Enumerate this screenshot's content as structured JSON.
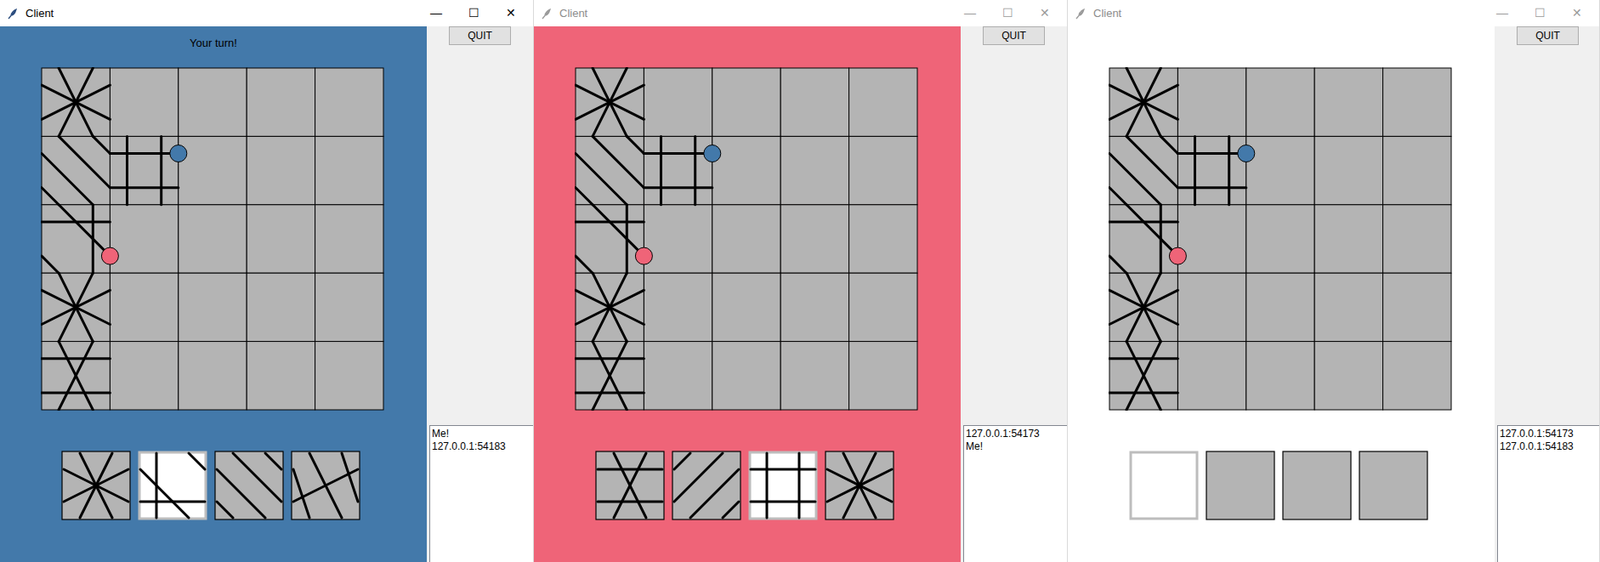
{
  "board": {
    "rows": 5,
    "cols": 5,
    "tiles": [
      {
        "row": 0,
        "col": 0,
        "paths": [
          [
            0,
            4
          ],
          [
            1,
            5
          ],
          [
            2,
            6
          ],
          [
            3,
            7
          ]
        ]
      },
      {
        "row": 1,
        "col": 0,
        "paths": [
          [
            1,
            2
          ],
          [
            0,
            3
          ],
          [
            7,
            4
          ],
          [
            6,
            5
          ]
        ]
      },
      {
        "row": 1,
        "col": 1,
        "paths": [
          [
            7,
            2
          ],
          [
            0,
            5
          ],
          [
            1,
            4
          ],
          [
            6,
            3
          ]
        ]
      },
      {
        "row": 2,
        "col": 0,
        "paths": [
          [
            7,
            2
          ],
          [
            1,
            4
          ],
          [
            6,
            5
          ],
          [
            0,
            3
          ]
        ]
      },
      {
        "row": 3,
        "col": 0,
        "paths": [
          [
            0,
            4
          ],
          [
            1,
            5
          ],
          [
            2,
            6
          ],
          [
            3,
            7
          ]
        ]
      },
      {
        "row": 4,
        "col": 0,
        "paths": [
          [
            7,
            2
          ],
          [
            0,
            4
          ],
          [
            1,
            5
          ],
          [
            6,
            3
          ]
        ]
      }
    ]
  },
  "tokens": [
    {
      "player": "blue",
      "color": "#4379aa",
      "col": 2,
      "row": 1.25
    },
    {
      "player": "red",
      "color": "#ef6478",
      "col": 1,
      "row": 2.75
    }
  ],
  "windows": [
    {
      "title": "Client",
      "focused": true,
      "controls": [
        "—",
        "☐",
        "✕"
      ],
      "canvas_color": "#4379aa",
      "status": "Your turn!",
      "hand": [
        {
          "selected": false,
          "paths": [
            [
              0,
              4
            ],
            [
              1,
              5
            ],
            [
              2,
              6
            ],
            [
              3,
              7
            ]
          ]
        },
        {
          "selected": true,
          "paths": [
            [
              0,
              5
            ],
            [
              1,
              2
            ],
            [
              6,
              3
            ],
            [
              7,
              4
            ]
          ]
        },
        {
          "selected": false,
          "paths": [
            [
              0,
              3
            ],
            [
              7,
              4
            ],
            [
              1,
              2
            ],
            [
              6,
              5
            ]
          ]
        },
        {
          "selected": false,
          "paths": [
            [
              1,
              3
            ],
            [
              0,
              4
            ],
            [
              7,
              5
            ],
            [
              2,
              6
            ]
          ]
        }
      ],
      "quit_button": "QUIT",
      "players_list": [
        "Me!",
        "127.0.0.1:54183"
      ]
    },
    {
      "title": "Client",
      "focused": false,
      "controls": [
        "—",
        "☐",
        "✕"
      ],
      "canvas_color": "#ef6478",
      "status": "",
      "hand": [
        {
          "selected": false,
          "paths": [
            [
              0,
              4
            ],
            [
              1,
              5
            ],
            [
              6,
              3
            ],
            [
              7,
              2
            ]
          ]
        },
        {
          "selected": false,
          "paths": [
            [
              1,
              6
            ],
            [
              0,
              7
            ],
            [
              2,
              5
            ],
            [
              3,
              4
            ]
          ]
        },
        {
          "selected": true,
          "paths": [
            [
              0,
              5
            ],
            [
              1,
              4
            ],
            [
              7,
              2
            ],
            [
              6,
              3
            ]
          ]
        },
        {
          "selected": false,
          "paths": [
            [
              0,
              4
            ],
            [
              1,
              5
            ],
            [
              2,
              6
            ],
            [
              3,
              7
            ]
          ]
        }
      ],
      "quit_button": "QUIT",
      "players_list": [
        "127.0.0.1:54173",
        "Me!"
      ]
    },
    {
      "title": "Client",
      "focused": false,
      "controls": [
        "—",
        "☐",
        "✕"
      ],
      "canvas_color": "#ffffff",
      "status": "",
      "hand": [
        {
          "selected": true,
          "paths": []
        },
        {
          "selected": false,
          "paths": []
        },
        {
          "selected": false,
          "paths": []
        },
        {
          "selected": false,
          "paths": []
        }
      ],
      "quit_button": "QUIT",
      "players_list": [
        "127.0.0.1:54173",
        "127.0.0.1:54183"
      ]
    }
  ]
}
